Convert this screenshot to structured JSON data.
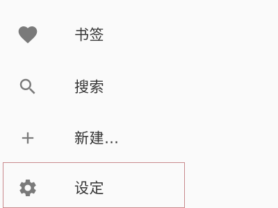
{
  "menu": {
    "items": [
      {
        "label": "书签",
        "icon": "heart-icon"
      },
      {
        "label": "搜索",
        "icon": "search-icon"
      },
      {
        "label": "新建…",
        "icon": "plus-icon"
      },
      {
        "label": "设定",
        "icon": "gear-icon"
      }
    ],
    "selected_index": 3
  },
  "colors": {
    "icon": "#7a7a7a",
    "text": "#333333",
    "highlight_border": "#c8888b",
    "background": "#fafafa"
  }
}
